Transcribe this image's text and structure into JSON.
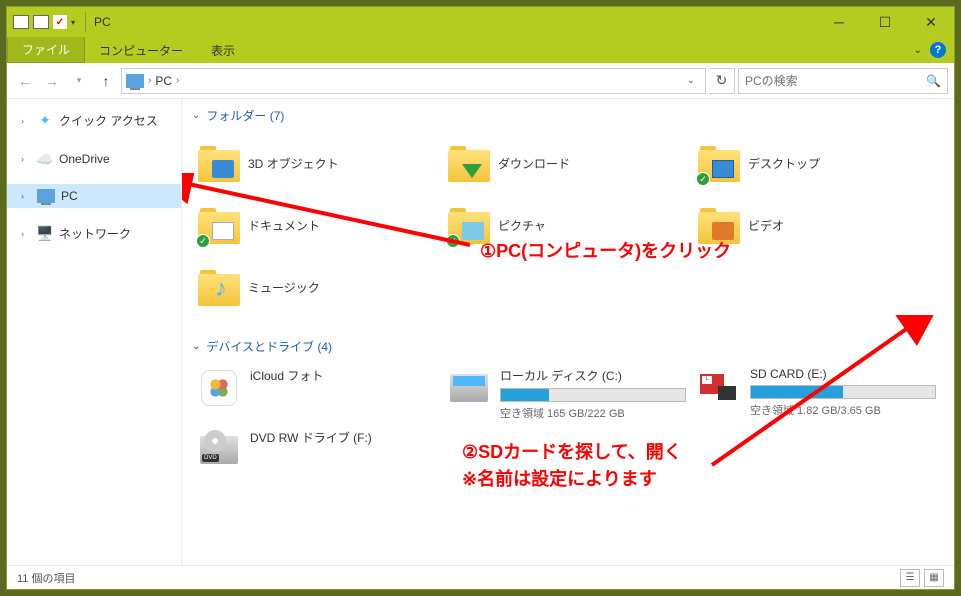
{
  "title": "PC",
  "menus": {
    "file": "ファイル",
    "computer": "コンピューター",
    "view": "表示"
  },
  "address": {
    "location": "PC"
  },
  "search": {
    "placeholder": "PCの検索"
  },
  "sidebar": {
    "quick": "クイック アクセス",
    "onedrive": "OneDrive",
    "pc": "PC",
    "network": "ネットワーク"
  },
  "groups": {
    "folders": "フォルダー (7)",
    "devices": "デバイスとドライブ (4)"
  },
  "folders": {
    "objects3d": "3D オブジェクト",
    "downloads": "ダウンロード",
    "desktop": "デスクトップ",
    "documents": "ドキュメント",
    "pictures": "ピクチャ",
    "videos": "ビデオ",
    "music": "ミュージック"
  },
  "drives": {
    "icloud": {
      "name": "iCloud フォト"
    },
    "local": {
      "name": "ローカル ディスク (C:)",
      "free": "空き領域 165 GB/222 GB",
      "fill": 26
    },
    "sd": {
      "name": "SD CARD (E:)",
      "free": "空き領域 1.82 GB/3.65 GB",
      "fill": 50
    },
    "dvd": {
      "name": "DVD RW ドライブ (F:)"
    }
  },
  "annotations": {
    "a1": "①PC(コンピュータ)をクリック",
    "a2_l1": "②SDカードを探して、開く",
    "a2_l2": "※名前は設定によります"
  },
  "status": {
    "items": "11 個の項目"
  }
}
